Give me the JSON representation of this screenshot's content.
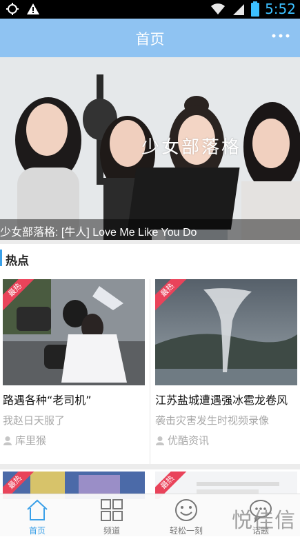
{
  "status_bar": {
    "time": "5:52",
    "icons": [
      "signal-alt-icon",
      "warning-icon",
      "wifi-icon",
      "cell-signal-icon",
      "battery-icon"
    ]
  },
  "header": {
    "title": "首页",
    "more_icon": "more-dots-icon"
  },
  "banner": {
    "overlay_text": "少女部落格",
    "caption": "少女部落格: [牛人] Love Me Like You Do"
  },
  "section": {
    "title": "热点"
  },
  "cards": [
    {
      "badge": "最热",
      "title": "路遇各种“老司机”",
      "subtitle": "我赵日天服了",
      "author": "库里猴"
    },
    {
      "badge": "最热",
      "title": "江苏盐城遭遇强冰雹龙卷风",
      "subtitle": "袭击灾害发生时视频录像",
      "author": "优酷资讯"
    },
    {
      "badge": "最热"
    },
    {
      "badge": "最热"
    }
  ],
  "tabs": [
    {
      "label": "首页",
      "icon": "home-icon",
      "active": true
    },
    {
      "label": "频道",
      "icon": "grid-icon",
      "active": false
    },
    {
      "label": "轻松一刻",
      "icon": "smile-icon",
      "active": false
    },
    {
      "label": "话题",
      "icon": "chat-icon",
      "active": false
    }
  ],
  "watermark": "悦佳信",
  "colors": {
    "header_bg": "#8fc3f2",
    "accent": "#3aa0e8",
    "badge_red": "#e9435a",
    "status_time": "#3cc0ff"
  }
}
